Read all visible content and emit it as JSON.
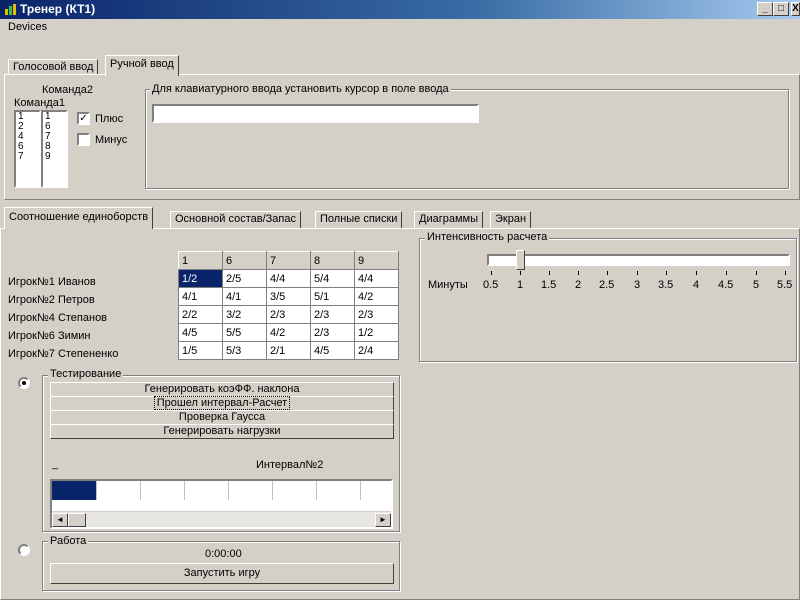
{
  "window": {
    "title": "Тренер (КТ1)",
    "minimize_glyph": "_",
    "maximize_glyph": "□",
    "close_glyph": "X"
  },
  "menu": {
    "items": [
      "Devices"
    ]
  },
  "input_tabs": {
    "tabs": [
      "Голосовой ввод",
      "Ручной ввод"
    ],
    "active": 1
  },
  "teams": {
    "team2_label": "Команда2",
    "team1_label": "Команда1",
    "team1_list": [
      "1",
      "2",
      "4",
      "6",
      "7"
    ],
    "team2_list": [
      "1",
      "6",
      "7",
      "8",
      "9"
    ],
    "plus_label": "Плюс",
    "plus_checked": true,
    "minus_label": "Минус",
    "minus_checked": false
  },
  "keyboard_group": {
    "label": "Для клавиатурного ввода установить курсор  в поле ввода",
    "value": ""
  },
  "main_tabs": {
    "tabs": [
      "Соотношение единоборств",
      "Основной состав/Запас",
      "Полные списки",
      "Диаграммы",
      "Экран"
    ],
    "active": 0
  },
  "matrix": {
    "columns": [
      "1",
      "6",
      "7",
      "8",
      "9"
    ],
    "rows": [
      {
        "label": "Игрок№1 Иванов",
        "cells": [
          "1/2",
          "2/5",
          "4/4",
          "5/4",
          "4/4"
        ]
      },
      {
        "label": "Игрок№2 Петров",
        "cells": [
          "4/1",
          "4/1",
          "3/5",
          "5/1",
          "4/2"
        ]
      },
      {
        "label": "Игрок№4 Степанов",
        "cells": [
          "2/2",
          "3/2",
          "2/3",
          "2/3",
          "2/3"
        ]
      },
      {
        "label": "Игрок№6 Зимин",
        "cells": [
          "4/5",
          "5/5",
          "4/2",
          "2/3",
          "1/2"
        ]
      },
      {
        "label": "Игрок№7 Степененко",
        "cells": [
          "1/5",
          "5/3",
          "2/1",
          "4/5",
          "2/4"
        ]
      }
    ]
  },
  "intensity": {
    "label": "Интенсивность расчета",
    "minutes_label": "Минуты",
    "scale": [
      "0.5",
      "1",
      "1.5",
      "2",
      "2.5",
      "3",
      "3.5",
      "4",
      "4.5",
      "5",
      "5.5"
    ],
    "value": "1"
  },
  "testing": {
    "label": "Тестирование",
    "selected": true,
    "buttons": [
      "Генерировать коэФФ. наклона",
      "Прошел интервал-Расчет",
      "Проверка Гаусса",
      "Генерировать нагрузки"
    ],
    "dash": "_",
    "interval_label": "Интервал№2",
    "progress_cells_filled": 1,
    "progress_cells_total": 8,
    "scroll_left_glyph": "◄",
    "scroll_right_glyph": "►"
  },
  "work": {
    "label": "Работа",
    "selected": false,
    "time": "0:00:00",
    "start_button": "Запустить игру"
  },
  "colors": {
    "selection": "#0a246a",
    "face": "#d4d0c8"
  }
}
